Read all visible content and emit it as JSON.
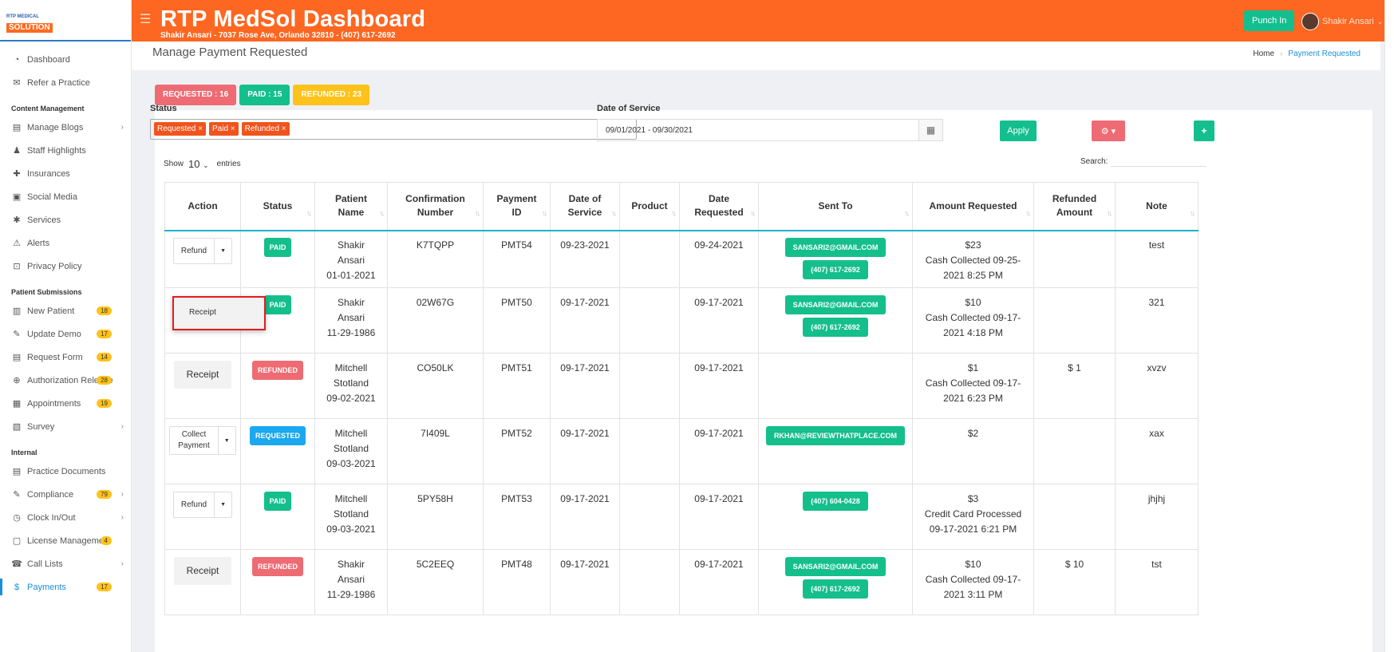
{
  "sidebar": {
    "logo_top": "RTP MEDICAL",
    "logo_bottom": "SOLUTION",
    "top_items": [
      {
        "label": "Dashboard",
        "icon": "dashboard-icon"
      },
      {
        "label": "Refer a Practice",
        "icon": "envelope-icon"
      }
    ],
    "content_section": "Content Management",
    "content_items": [
      {
        "label": "Manage Blogs",
        "icon": "blog-icon",
        "chevron": true
      },
      {
        "label": "Staff Highlights",
        "icon": "staff-icon"
      },
      {
        "label": "Insurances",
        "icon": "insurance-icon"
      },
      {
        "label": "Social Media",
        "icon": "social-icon"
      },
      {
        "label": "Services",
        "icon": "services-icon"
      },
      {
        "label": "Alerts",
        "icon": "alerts-icon"
      },
      {
        "label": "Privacy Policy",
        "icon": "privacy-icon"
      }
    ],
    "patient_section": "Patient Submissions",
    "patient_items": [
      {
        "label": "New Patient",
        "badge": "18",
        "icon": "clipboard-icon"
      },
      {
        "label": "Update Demo",
        "badge": "17",
        "icon": "edit-icon"
      },
      {
        "label": "Request Form",
        "badge": "14",
        "icon": "form-icon"
      },
      {
        "label": "Authorization Release",
        "badge": "28",
        "icon": "authorization-icon"
      },
      {
        "label": "Appointments",
        "badge": "19",
        "icon": "calendar-icon"
      },
      {
        "label": "Survey",
        "icon": "survey-icon",
        "chevron": true
      }
    ],
    "internal_section": "Internal",
    "internal_items": [
      {
        "label": "Practice Documents",
        "icon": "documents-icon"
      },
      {
        "label": "Compliance",
        "badge": "79",
        "icon": "compliance-icon",
        "chevron": true
      },
      {
        "label": "Clock In/Out",
        "icon": "clock-icon",
        "chevron": true
      },
      {
        "label": "License Management",
        "badge": "4",
        "icon": "license-icon"
      },
      {
        "label": "Call Lists",
        "icon": "call-list-icon",
        "chevron": true
      },
      {
        "label": "Payments",
        "badge": "17",
        "icon": "payments-icon",
        "active": true
      }
    ]
  },
  "header": {
    "title": "RTP MedSol Dashboard",
    "subtitle": "Shakir Ansari - 7037 Rose Ave, Orlando 32810 - (407) 617-2692",
    "punch_label": "Punch In",
    "user_name": "Shakir Ansari",
    "accent_color": "#fd6721"
  },
  "page": {
    "title": "Manage Payment Requested",
    "breadcrumb_home": "Home",
    "breadcrumb_current": "Payment Requested"
  },
  "summary": {
    "requested": "REQUESTED : 16",
    "paid": "PAID : 15",
    "refunded": "REFUNDED : 23"
  },
  "filters": {
    "status_label": "Status",
    "status_chips": [
      "Requested ×",
      "Paid ×",
      "Refunded ×"
    ],
    "date_label": "Date of Service",
    "date_value": "09/01/2021 - 09/30/2021",
    "apply_label": "Apply",
    "settings_label": "⚙ ▾",
    "add_label": "+"
  },
  "table_controls": {
    "show_label": "Show",
    "show_value": "10",
    "entries_label": "entries",
    "search_label": "Search:"
  },
  "table": {
    "headers": [
      "Action",
      "Status",
      "Patient Name",
      "Confirmation Number",
      "Payment ID",
      "Date of Service",
      "Product",
      "Date Requested",
      "Sent To",
      "Amount Requested",
      "Refunded Amount",
      "Note"
    ],
    "rows": [
      {
        "action": "Refund",
        "action_type": "split",
        "status": "PAID",
        "status_type": "paid",
        "patient": [
          "Shakir",
          "Ansari",
          "01-01-2021"
        ],
        "confirmation": "K7TQPP",
        "payment_id": "PMT54",
        "dos": "09-23-2021",
        "product": "",
        "requested": "09-24-2021",
        "sent_to": [
          "SANSARI2@GMAIL.COM",
          "(407) 617-2692"
        ],
        "amount": [
          "$23",
          "Cash Collected 09-25-",
          "2021 8:25 PM"
        ],
        "refunded": "",
        "note": "test"
      },
      {
        "action": "",
        "action_type": "none",
        "status": "PAID",
        "status_type": "paid",
        "patient": [
          "Shakir",
          "Ansari",
          "11-29-1986"
        ],
        "confirmation": "02W67G",
        "payment_id": "PMT50",
        "dos": "09-17-2021",
        "product": "",
        "requested": "09-17-2021",
        "sent_to": [
          "SANSARI2@GMAIL.COM",
          "(407) 617-2692"
        ],
        "amount": [
          "$10",
          "Cash Collected 09-17-",
          "2021 4:18 PM"
        ],
        "refunded": "",
        "note": "321"
      },
      {
        "action": "Receipt",
        "action_type": "receipt",
        "status": "REFUNDED",
        "status_type": "refunded",
        "patient": [
          "Mitchell",
          "Stotland",
          "09-02-2021"
        ],
        "confirmation": "CO50LK",
        "payment_id": "PMT51",
        "dos": "09-17-2021",
        "product": "",
        "requested": "09-17-2021",
        "sent_to": [],
        "amount": [
          "$1",
          "Cash Collected 09-17-",
          "2021 6:23 PM"
        ],
        "refunded": "$ 1",
        "note": "xvzv"
      },
      {
        "action": "Collect|Payment",
        "action_type": "split2",
        "status": "REQUESTED",
        "status_type": "requested",
        "patient": [
          "Mitchell",
          "Stotland",
          "09-03-2021"
        ],
        "confirmation": "7I409L",
        "payment_id": "PMT52",
        "dos": "09-17-2021",
        "product": "",
        "requested": "09-17-2021",
        "sent_to": [
          "RKHAN@REVIEWTHATPLACE.COM"
        ],
        "amount": [
          "$2"
        ],
        "refunded": "",
        "note": "xax"
      },
      {
        "action": "Refund",
        "action_type": "split",
        "status": "PAID",
        "status_type": "paid",
        "patient": [
          "Mitchell",
          "Stotland",
          "09-03-2021"
        ],
        "confirmation": "5PY58H",
        "payment_id": "PMT53",
        "dos": "09-17-2021",
        "product": "",
        "requested": "09-17-2021",
        "sent_to": [
          "(407) 604-0428"
        ],
        "amount": [
          "$3",
          "Credit Card Processed",
          "09-17-2021 6:21 PM"
        ],
        "refunded": "",
        "note": "jhjhj"
      },
      {
        "action": "Receipt",
        "action_type": "receipt",
        "status": "REFUNDED",
        "status_type": "refunded",
        "patient": [
          "Shakir",
          "Ansari",
          "11-29-1986"
        ],
        "confirmation": "5C2EEQ",
        "payment_id": "PMT48",
        "dos": "09-17-2021",
        "product": "",
        "requested": "09-17-2021",
        "sent_to": [
          "SANSARI2@GMAIL.COM",
          "(407) 617-2692"
        ],
        "amount": [
          "$10",
          "Cash Collected 09-17-",
          "2021 3:11 PM"
        ],
        "refunded": "$ 10",
        "note": "tst"
      }
    ]
  },
  "popup": {
    "receipt_label": "Receipt"
  }
}
